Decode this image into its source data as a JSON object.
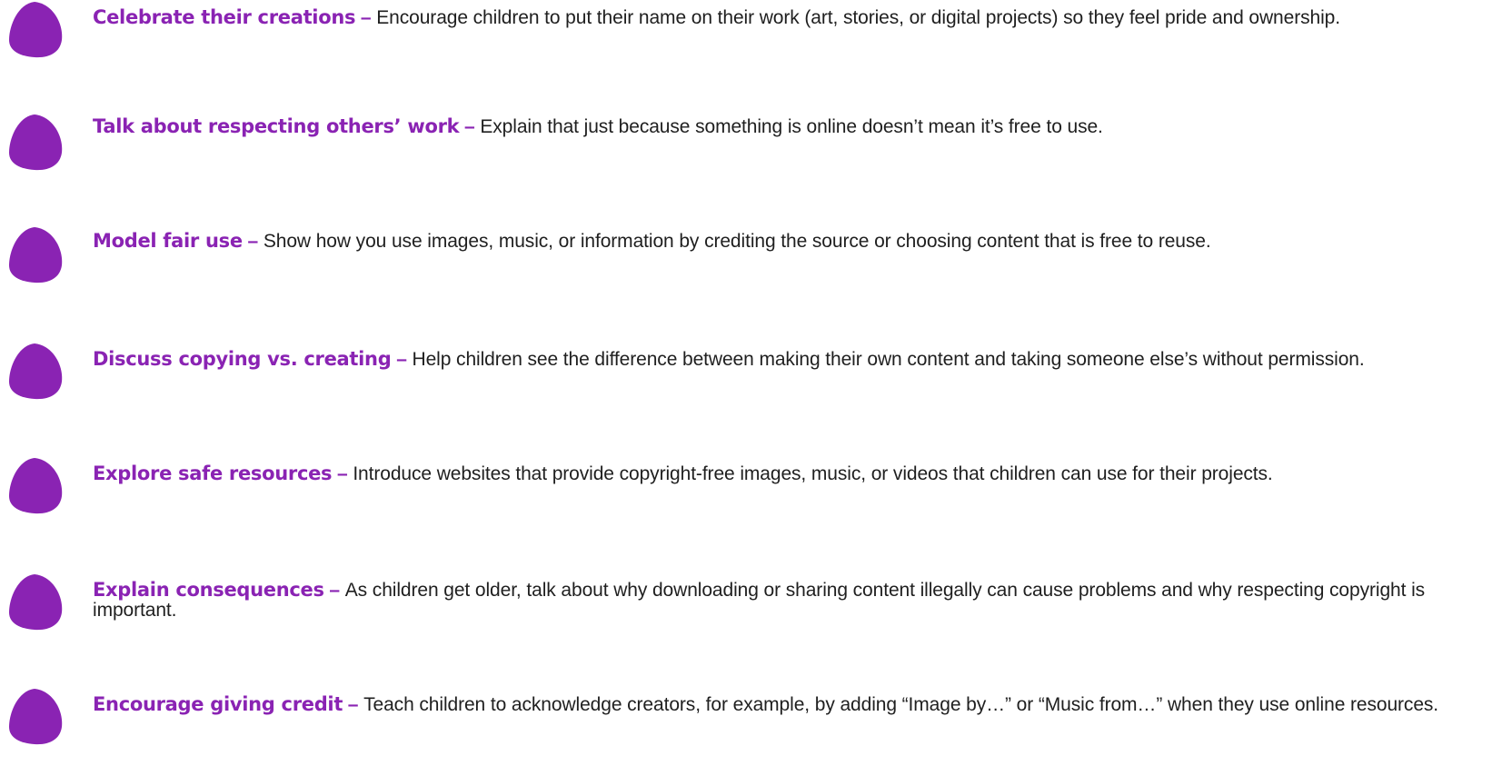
{
  "colors": {
    "accent": "#8a23b3",
    "text": "#1f1f1f",
    "background": "#ffffff"
  },
  "tips": [
    {
      "icon": "purple-blob-icon",
      "title": "Celebrate their creations",
      "separator": " – ",
      "body": "Encourage children to put their name on their work (art, stories, or digital projects) so they feel pride and ownership."
    },
    {
      "icon": "purple-blob-icon",
      "title": "Talk about respecting others’ work",
      "separator": " – ",
      "body": "Explain that just because something is online doesn’t mean it’s free to use."
    },
    {
      "icon": "purple-blob-icon",
      "title": "Model fair use",
      "separator": " – ",
      "body": "Show how you use images, music, or information by crediting the source or choosing content that is free to reuse."
    },
    {
      "icon": "purple-blob-icon",
      "title": "Discuss copying vs. creating",
      "separator": " – ",
      "body": "Help children see the difference between making their own content and taking someone else’s without permission."
    },
    {
      "icon": "purple-blob-icon",
      "title": "Explore safe resources",
      "separator": " – ",
      "body": "Introduce websites that provide copyright-free images, music, or videos that children can use for their projects."
    },
    {
      "icon": "purple-blob-icon",
      "title": "Explain consequences",
      "separator": " – ",
      "body": "As children get older, talk about why downloading or sharing content illegally can cause problems and why respecting copyright is important."
    },
    {
      "icon": "purple-blob-icon",
      "title": "Encourage giving credit",
      "separator": " – ",
      "body": "Teach children to acknowledge creators, for example, by adding “Image by…” or “Music from…” when they use online resources."
    }
  ]
}
